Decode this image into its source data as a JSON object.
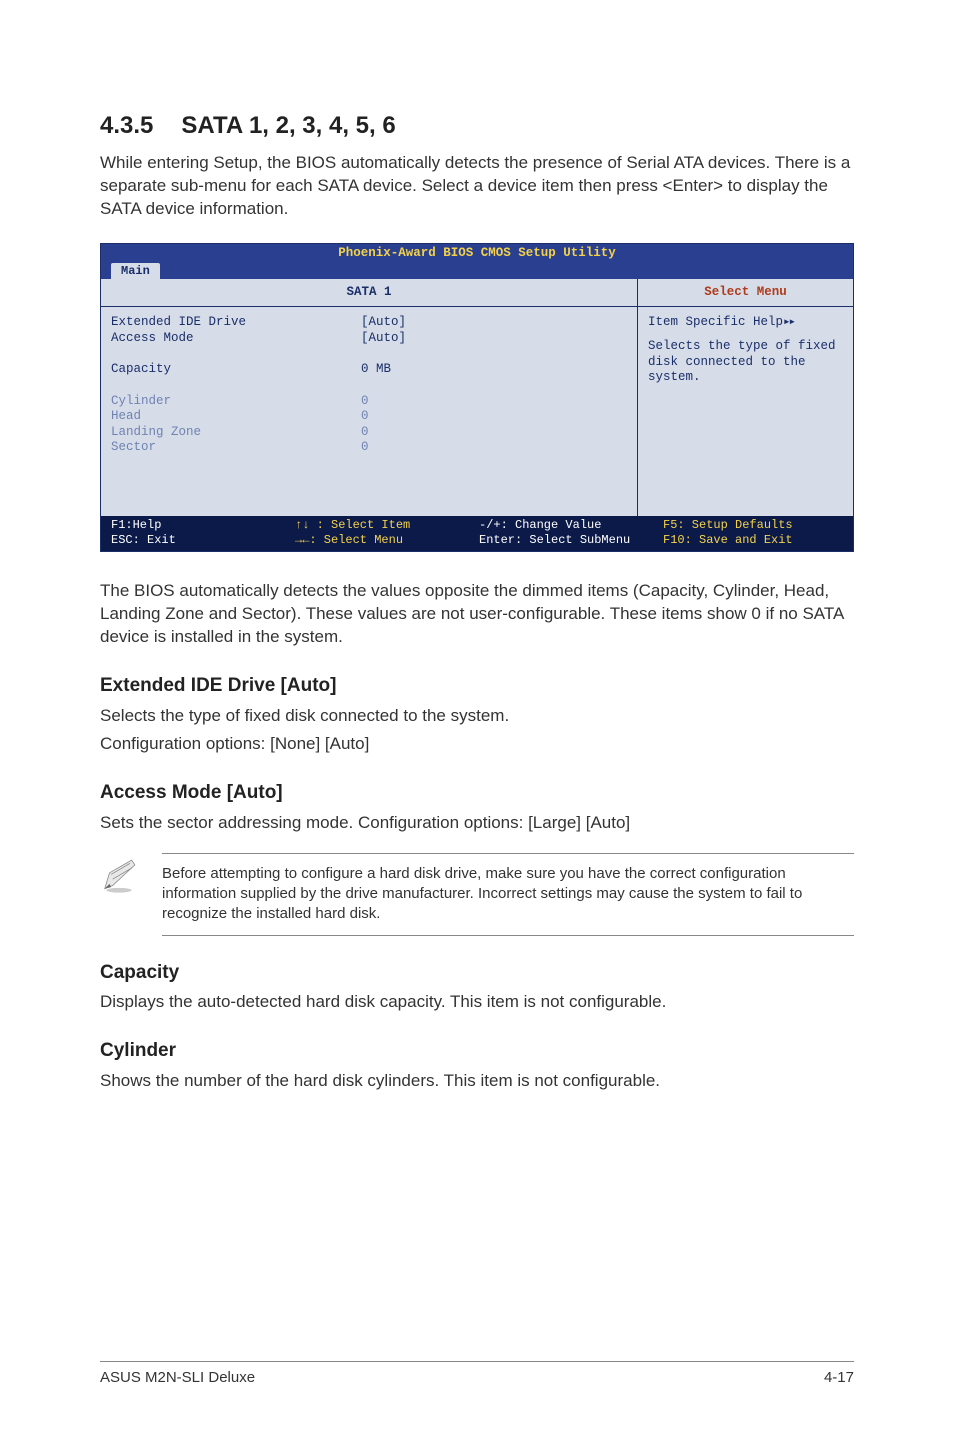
{
  "section": {
    "number": "4.3.5",
    "title": "SATA 1, 2, 3, 4, 5, 6",
    "intro": "While entering Setup, the BIOS automatically detects the presence of Serial ATA devices. There is a separate sub-menu for each SATA device. Select a device item then press <Enter> to display the SATA device information."
  },
  "bios": {
    "utility_title": "Phoenix-Award BIOS CMOS Setup Utility",
    "tab": "Main",
    "left_header": "SATA 1",
    "right_header": "Select Menu",
    "rows": {
      "extended_ide_drive": {
        "label": "Extended IDE Drive",
        "value": "[Auto]",
        "dim": false
      },
      "access_mode": {
        "label": "Access Mode",
        "value": "[Auto]",
        "dim": false
      },
      "capacity": {
        "label": "Capacity",
        "value": "0 MB",
        "dim": false
      },
      "cylinder": {
        "label": "Cylinder",
        "value": "0",
        "dim": true
      },
      "head": {
        "label": "Head",
        "value": "0",
        "dim": true
      },
      "landing_zone": {
        "label": "Landing Zone",
        "value": "0",
        "dim": true
      },
      "sector": {
        "label": "Sector",
        "value": "0",
        "dim": true
      }
    },
    "help": {
      "title": "Item Specific Help",
      "body": "Selects the type of fixed disk connected to the system."
    },
    "footer": {
      "f1": "F1:Help",
      "updown": "↑↓ : Select Item",
      "pm": "-/+: Change Value",
      "f5": "F5: Setup Defaults",
      "esc": "ESC: Exit",
      "lr": "→←: Select Menu",
      "enter": "Enter: Select SubMenu",
      "f10": "F10: Save and Exit"
    }
  },
  "after_bios": "The BIOS automatically detects the values opposite the dimmed items (Capacity, Cylinder,  Head, Landing Zone and Sector). These values are not user-configurable. These items show 0 if no SATA device is installed in the system.",
  "ext_ide": {
    "heading": "Extended IDE Drive [Auto]",
    "line1": "Selects the type of fixed disk connected to the system.",
    "line2": "Configuration options: [None] [Auto]"
  },
  "access_mode": {
    "heading": "Access Mode [Auto]",
    "line": "Sets the sector addressing mode. Configuration options: [Large] [Auto]"
  },
  "note": "Before attempting to configure a hard disk drive, make sure you have the correct configuration information supplied by the drive manufacturer. Incorrect settings may cause the system to fail to recognize the installed hard disk.",
  "capacity": {
    "heading": "Capacity",
    "line": "Displays the auto-detected hard disk capacity. This item is not configurable."
  },
  "cylinder": {
    "heading": "Cylinder",
    "line": "Shows the number of the hard disk cylinders. This item is not configurable."
  },
  "footer": {
    "left": "ASUS M2N-SLI Deluxe",
    "right": "4-17"
  }
}
